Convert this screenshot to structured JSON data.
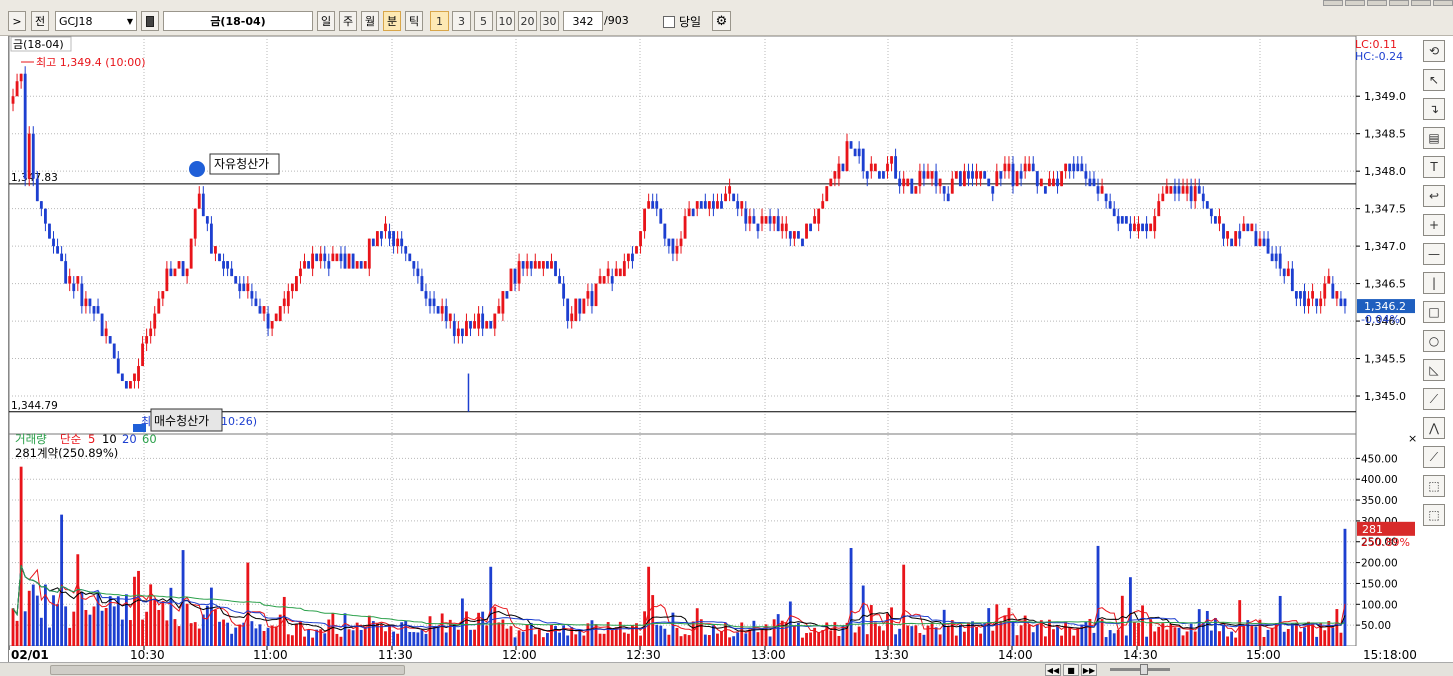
{
  "toolbar": {
    "next_btn": ">",
    "prev_btn": "전",
    "symbol_code": "GCJ18",
    "symbol_name": "금(18-04)",
    "period_labels": [
      "일",
      "주",
      "월",
      "분",
      "틱"
    ],
    "selected_period": "분",
    "interval_labels": [
      "1",
      "3",
      "5",
      "10",
      "20",
      "30"
    ],
    "selected_interval": "1",
    "count_value": "342",
    "count_total": "/903",
    "today_label": "당일"
  },
  "chart": {
    "title": "금(18-04)",
    "lc_label": "LC:0.11",
    "hc_label": "HC:-0.24",
    "high_annotation": "최고 1,349.4 (10:00)",
    "low_annotation_left": "최",
    "low_annotation_box": "매수청산가",
    "low_annotation_right": "10:26)",
    "liquidation_label": "자유청산가",
    "line_upper_value": "1,347.83",
    "line_lower_value": "1,344.79",
    "current_price": "1,346.2",
    "current_change": "-0.04%",
    "volume_legend": {
      "name": "거래량",
      "ma_type": "단순",
      "ma_periods": [
        "5",
        "10",
        "20",
        "60"
      ]
    },
    "volume_info": "281계약(250.89%)",
    "current_volume": "281",
    "current_volume_pct": "250.89%",
    "date_label": "02/01",
    "end_time": "15:18:00",
    "colors": {
      "up": "#e8141a",
      "down": "#1d3fd0",
      "ma5": "#e8141a",
      "ma10": "#000000",
      "ma20": "#1d3fd0",
      "ma60": "#2aa04a",
      "grid": "#b8b8b8",
      "current_price_bg": "#1f5fbf",
      "current_volume_bg": "#d82a2a"
    }
  },
  "chart_data": {
    "type": "candlestick+bar",
    "price_axis_ticks": [
      "1,349.0",
      "1,348.5",
      "1,348.0",
      "1,347.5",
      "1,347.0",
      "1,346.5",
      "1,346.0",
      "1,345.5",
      "1,345.0"
    ],
    "volume_axis_ticks": [
      "450.00",
      "400.00",
      "350.00",
      "300.00",
      "250.00",
      "200.00",
      "150.00",
      "100.00",
      "50.00"
    ],
    "time_axis_ticks": [
      "02/01",
      "10:30",
      "11:00",
      "11:30",
      "12:00",
      "12:30",
      "13:00",
      "13:30",
      "14:00",
      "14:30",
      "15:00",
      "15:18:00"
    ],
    "price_ylim": [
      1344.6,
      1349.75
    ],
    "volume_ylim": [
      0,
      470
    ],
    "high": 1349.4,
    "low": 1344.79,
    "last": 1346.2,
    "reference_lines": [
      1347.83,
      1344.79
    ],
    "close_path": [
      {
        "t": 0.0,
        "p": 1349.0
      },
      {
        "t": 0.01,
        "p": 1349.3
      },
      {
        "t": 0.02,
        "p": 1347.8
      },
      {
        "t": 0.03,
        "p": 1347.3
      },
      {
        "t": 0.05,
        "p": 1346.6
      },
      {
        "t": 0.07,
        "p": 1346.3
      },
      {
        "t": 0.09,
        "p": 1345.8
      },
      {
        "t": 0.1,
        "p": 1345.4
      },
      {
        "t": 0.11,
        "p": 1345.0
      },
      {
        "t": 0.12,
        "p": 1345.3
      },
      {
        "t": 0.13,
        "p": 1345.9
      },
      {
        "t": 0.15,
        "p": 1346.6
      },
      {
        "t": 0.17,
        "p": 1346.8
      },
      {
        "t": 0.18,
        "p": 1347.8
      },
      {
        "t": 0.19,
        "p": 1347.1
      },
      {
        "t": 0.21,
        "p": 1346.6
      },
      {
        "t": 0.23,
        "p": 1346.4
      },
      {
        "t": 0.24,
        "p": 1346.1
      },
      {
        "t": 0.25,
        "p": 1345.9
      },
      {
        "t": 0.26,
        "p": 1346.1
      },
      {
        "t": 0.28,
        "p": 1346.7
      },
      {
        "t": 0.3,
        "p": 1346.9
      },
      {
        "t": 0.32,
        "p": 1346.8
      },
      {
        "t": 0.34,
        "p": 1346.8
      },
      {
        "t": 0.36,
        "p": 1347.3
      },
      {
        "t": 0.38,
        "p": 1346.8
      },
      {
        "t": 0.4,
        "p": 1346.4
      },
      {
        "t": 0.42,
        "p": 1346.1
      },
      {
        "t": 0.43,
        "p": 1345.8
      },
      {
        "t": 0.45,
        "p": 1346.0
      },
      {
        "t": 0.47,
        "p": 1346.0
      },
      {
        "t": 0.48,
        "p": 1346.5
      },
      {
        "t": 0.5,
        "p": 1346.8
      },
      {
        "t": 0.52,
        "p": 1346.8
      },
      {
        "t": 0.53,
        "p": 1346.5
      },
      {
        "t": 0.54,
        "p": 1346.1
      },
      {
        "t": 0.56,
        "p": 1346.3
      },
      {
        "t": 0.58,
        "p": 1346.5
      },
      {
        "t": 0.6,
        "p": 1346.9
      },
      {
        "t": 0.61,
        "p": 1347.2
      },
      {
        "t": 0.62,
        "p": 1347.7
      },
      {
        "t": 0.63,
        "p": 1347.2
      },
      {
        "t": 0.64,
        "p": 1346.9
      },
      {
        "t": 0.66,
        "p": 1347.5
      },
      {
        "t": 0.68,
        "p": 1347.6
      },
      {
        "t": 0.7,
        "p": 1347.6
      },
      {
        "t": 0.72,
        "p": 1347.3
      },
      {
        "t": 0.74,
        "p": 1347.3
      },
      {
        "t": 0.76,
        "p": 1347.1
      },
      {
        "t": 0.78,
        "p": 1347.4
      },
      {
        "t": 0.8,
        "p": 1347.9
      },
      {
        "t": 0.81,
        "p": 1348.3
      },
      {
        "t": 0.83,
        "p": 1348.1
      },
      {
        "t": 0.85,
        "p": 1348.1
      },
      {
        "t": 0.87,
        "p": 1347.8
      },
      {
        "t": 0.89,
        "p": 1347.9
      },
      {
        "t": 0.91,
        "p": 1347.8
      },
      {
        "t": 0.93,
        "p": 1348.0
      },
      {
        "t": 0.95,
        "p": 1347.9
      },
      {
        "t": 0.97,
        "p": 1348.0
      },
      {
        "t": 1.0,
        "p": 1347.9
      }
    ],
    "close_path_2": [
      {
        "t": 0.0,
        "p": 1347.9
      },
      {
        "t": 0.05,
        "p": 1348.2
      },
      {
        "t": 0.1,
        "p": 1347.7
      },
      {
        "t": 0.15,
        "p": 1347.9
      },
      {
        "t": 0.2,
        "p": 1348.1
      },
      {
        "t": 0.25,
        "p": 1347.8
      },
      {
        "t": 0.3,
        "p": 1347.4
      },
      {
        "t": 0.35,
        "p": 1347.2
      },
      {
        "t": 0.4,
        "p": 1347.2
      },
      {
        "t": 0.45,
        "p": 1347.6
      },
      {
        "t": 0.5,
        "p": 1347.8
      },
      {
        "t": 0.55,
        "p": 1347.7
      },
      {
        "t": 0.6,
        "p": 1347.4
      },
      {
        "t": 0.65,
        "p": 1347.0
      },
      {
        "t": 0.7,
        "p": 1347.3
      },
      {
        "t": 0.75,
        "p": 1347.0
      },
      {
        "t": 0.8,
        "p": 1346.8
      },
      {
        "t": 0.85,
        "p": 1346.5
      },
      {
        "t": 0.9,
        "p": 1346.2
      },
      {
        "t": 0.95,
        "p": 1346.5
      },
      {
        "t": 1.0,
        "p": 1346.2
      }
    ],
    "volume_spikes": [
      {
        "t": 0.006,
        "v": 430
      },
      {
        "t": 0.035,
        "v": 315
      },
      {
        "t": 0.05,
        "v": 220
      },
      {
        "t": 0.095,
        "v": 180
      },
      {
        "t": 0.128,
        "v": 230
      },
      {
        "t": 0.177,
        "v": 200
      },
      {
        "t": 0.36,
        "v": 190
      },
      {
        "t": 0.495,
        "v": 80
      },
      {
        "t": 0.478,
        "v": 190
      },
      {
        "t": 0.628,
        "v": 235
      },
      {
        "t": 0.638,
        "v": 145
      },
      {
        "t": 0.67,
        "v": 195
      },
      {
        "t": 0.815,
        "v": 240
      },
      {
        "t": 0.84,
        "v": 165
      },
      {
        "t": 0.92,
        "v": 110
      },
      {
        "t": 0.95,
        "v": 120
      },
      {
        "t": 1.0,
        "v": 281
      }
    ]
  }
}
